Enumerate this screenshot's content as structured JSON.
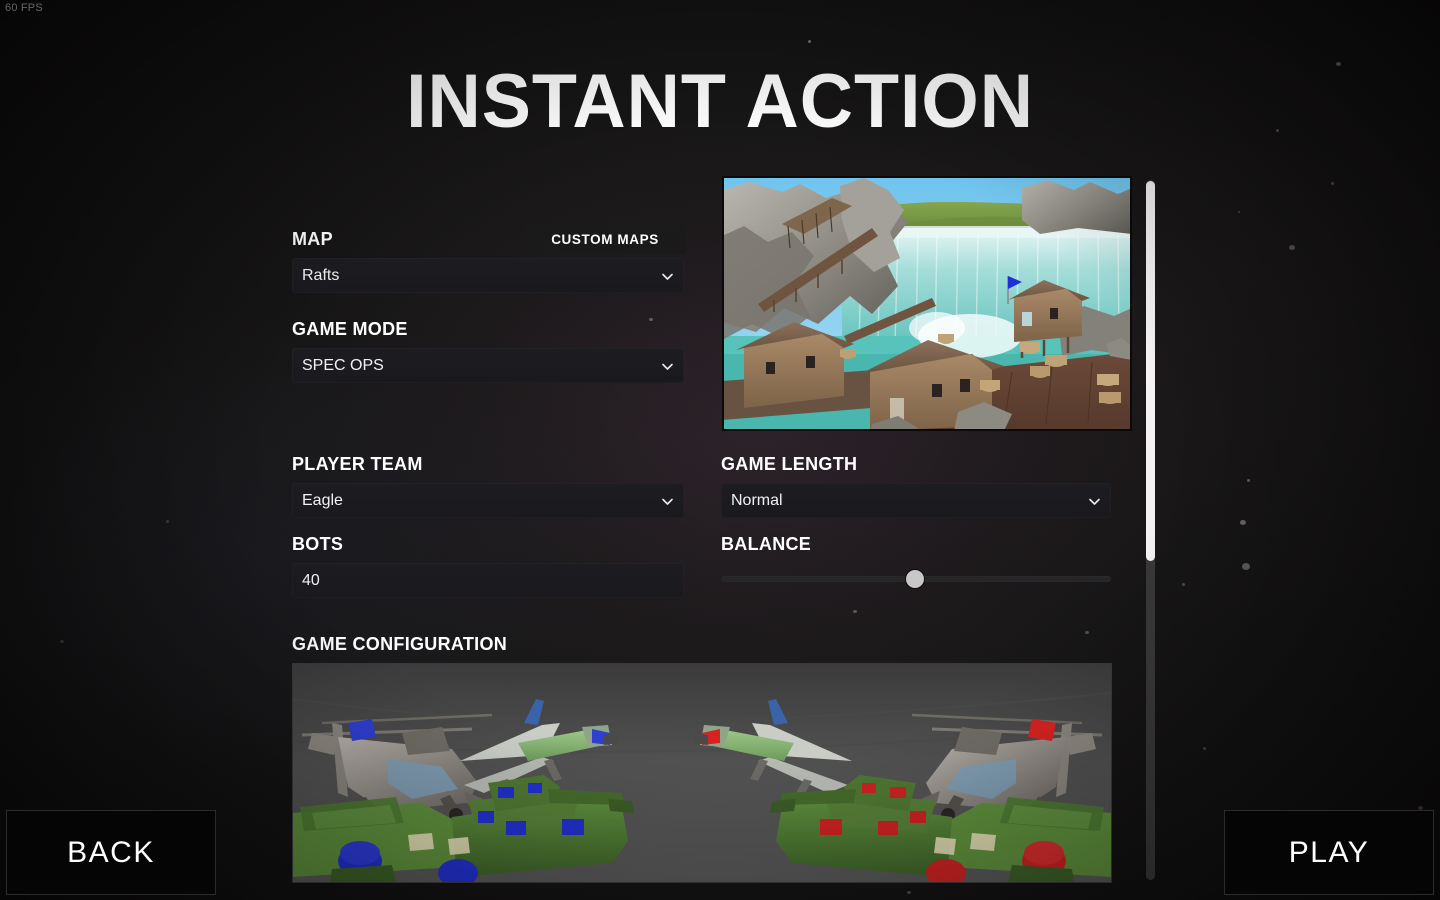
{
  "hud": {
    "fps": "60 FPS"
  },
  "page": {
    "title": "INSTANT ACTION"
  },
  "colors": {
    "background": "#141313",
    "panel_field": "#1a1a1e",
    "text_primary": "#ffffff",
    "accent_glow": "#783a6a",
    "slider_handle": "#c8c8c8",
    "scrollbar_thumb": "#f4f2f4",
    "team_blue": "#1f2fd8",
    "team_red": "#d81f1f"
  },
  "form": {
    "map": {
      "label": "MAP",
      "value": "Rafts",
      "chevron_icon": "chevron-down-icon",
      "custom_maps_button": "CUSTOM MAPS"
    },
    "game_mode": {
      "label": "GAME MODE",
      "value": "SPEC OPS",
      "chevron_icon": "chevron-down-icon"
    },
    "player_team": {
      "label": "PLAYER TEAM",
      "value": "Eagle",
      "chevron_icon": "chevron-down-icon"
    },
    "bots": {
      "label": "BOTS",
      "value": "40"
    },
    "game_length": {
      "label": "GAME LENGTH",
      "value": "Normal",
      "chevron_icon": "chevron-down-icon"
    },
    "balance": {
      "label": "BALANCE",
      "value_percent": 50
    },
    "game_configuration": {
      "label": "GAME CONFIGURATION"
    }
  },
  "map_preview": {
    "scene": "rafts-waterfall-map-thumbnail",
    "description": "Wooden raft buildings on docks before a large teal waterfall with rocky cliffs and green hills"
  },
  "config_preview": {
    "scene": "vehicle-lineup-preview",
    "description": "Blue team and red team vehicles: tanks, jeeps, helicopters and propeller planes"
  },
  "scrollbar": {
    "thumb_position_percent": 0,
    "thumb_size_percent": 54
  },
  "footer": {
    "back_button": "BACK",
    "play_button": "PLAY"
  }
}
